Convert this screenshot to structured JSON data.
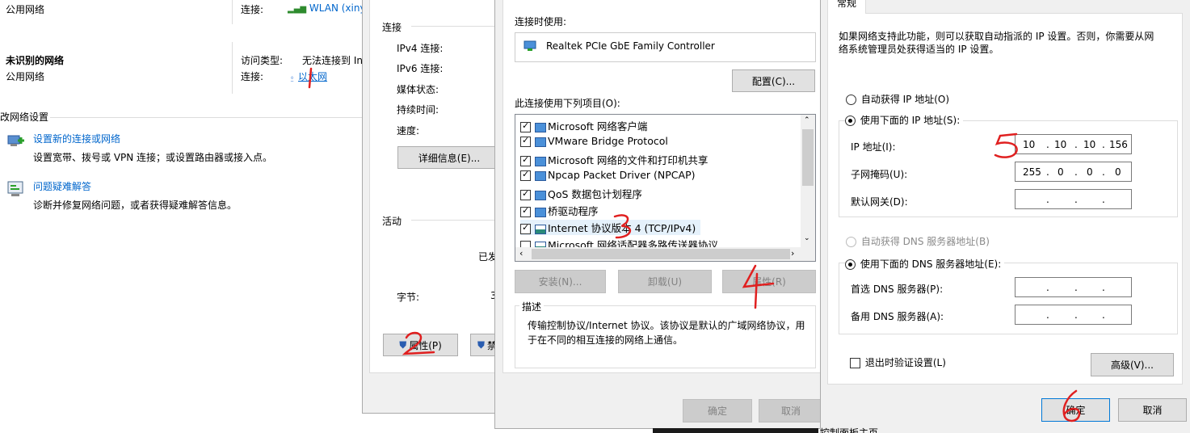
{
  "left": {
    "network1_type": "公用网络",
    "conn_label": "连接:",
    "wlan_name": "WLAN (xinyu",
    "unknown_network": "未识别的网络",
    "network2_type": "公用网络",
    "access_type_label": "访问类型:",
    "access_type_value": "无法连接到 In",
    "conn_label2": "连接:",
    "ethernet": "以太网",
    "change_settings": "改网络设置",
    "setup_link": "设置新的连接或网络",
    "setup_desc": "设置宽带、拨号或 VPN 连接；或设置路由器或接入点。",
    "troubleshoot_link": "问题疑难解答",
    "troubleshoot_desc": "诊断并修复网络问题，或者获得疑难解答信息。"
  },
  "status": {
    "conn_header": "连接",
    "ipv4": "IPv4 连接:",
    "ipv6": "IPv6 连接:",
    "media": "媒体状态:",
    "duration": "持续时间:",
    "speed": "速度:",
    "details_btn": "详细信息(E)...",
    "activity": "活动",
    "sent": "已发",
    "bytes": "字节:",
    "bytes_val": "3",
    "properties_btn": "属性(P)",
    "disable_btn_partial": "禁"
  },
  "props": {
    "connect_using": "连接时使用:",
    "adapter": "Realtek PCIe GbE Family Controller",
    "configure_btn": "配置(C)...",
    "items_label": "此连接使用下列项目(O):",
    "items": [
      {
        "label": "Microsoft 网络客户端",
        "checked": true
      },
      {
        "label": "VMware Bridge Protocol",
        "checked": true
      },
      {
        "label": "Microsoft 网络的文件和打印机共享",
        "checked": true
      },
      {
        "label": "Npcap Packet Driver (NPCAP)",
        "checked": true
      },
      {
        "label": "QoS 数据包计划程序",
        "checked": true
      },
      {
        "label": "桥驱动程序",
        "checked": true
      },
      {
        "label": "Internet 协议版本 4 (TCP/IPv4)",
        "checked": true
      },
      {
        "label": "Microsoft 网络适配器多路传送器协议",
        "checked": false
      }
    ],
    "install_btn": "安装(N)...",
    "uninstall_btn": "卸载(U)",
    "properties_btn": "属性(R)",
    "desc_title": "描述",
    "desc_text_1": "传输控制协议/Internet 协议。该协议是默认的广域网络协议，用",
    "desc_text_2": "于在不同的相互连接的网络上通信。",
    "ok_btn": "确定",
    "cancel_btn": "取消"
  },
  "ipv4": {
    "tab": "常规",
    "intro_1": "如果网络支持此功能，则可以获取自动指派的 IP 设置。否则，你需要从网",
    "intro_2": "络系统管理员处获得适当的 IP 设置。",
    "auto_ip": "自动获得 IP 地址(O)",
    "manual_ip": "使用下面的 IP 地址(S):",
    "ip_label": "IP 地址(I):",
    "ip_value": [
      "10",
      "10",
      "10",
      "156"
    ],
    "mask_label": "子网掩码(U):",
    "mask_value": [
      "255",
      "0",
      "0",
      "0"
    ],
    "gateway_label": "默认网关(D):",
    "auto_dns": "自动获得 DNS 服务器地址(B)",
    "manual_dns": "使用下面的 DNS 服务器地址(E):",
    "dns1_label": "首选 DNS 服务器(P):",
    "dns2_label": "备用 DNS 服务器(A):",
    "validate": "退出时验证设置(L)",
    "advanced_btn": "高级(V)...",
    "ok_btn": "确定",
    "cancel_btn": "取消",
    "bottom_partial": "控制面板主页"
  },
  "annotations": [
    "1",
    "2",
    "3",
    "4",
    "5",
    "6"
  ]
}
